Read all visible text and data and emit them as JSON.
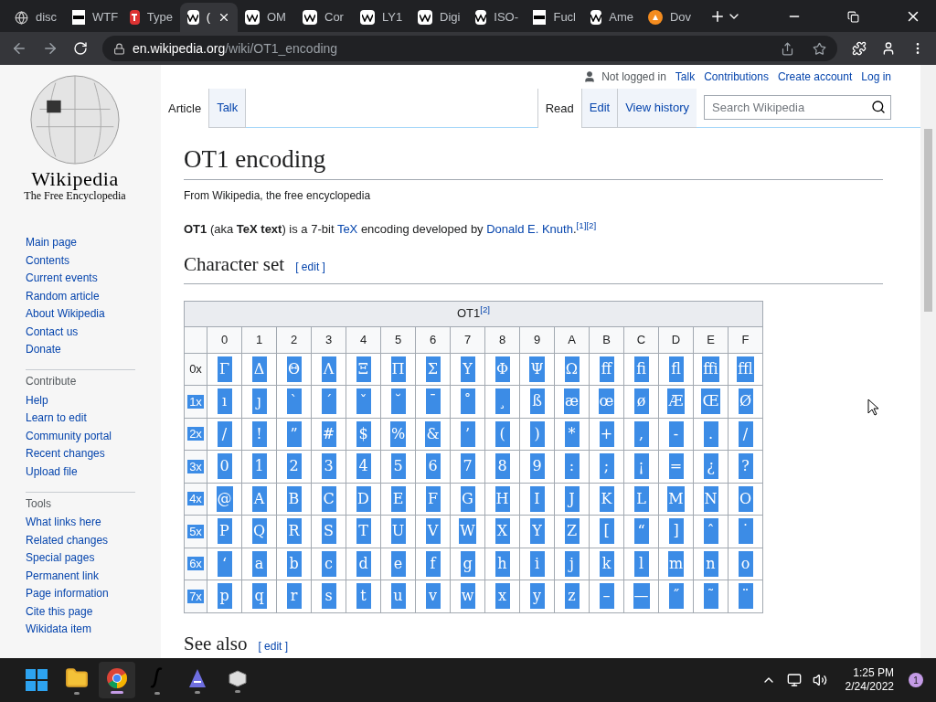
{
  "browser": {
    "tabs": [
      {
        "title": "disc",
        "kind": "globe",
        "selected": false
      },
      {
        "title": "WTF",
        "kind": "wtf",
        "selected": false
      },
      {
        "title": "Type",
        "kind": "t",
        "selected": false
      },
      {
        "title": "(",
        "kind": "w",
        "selected": true
      },
      {
        "title": "OM",
        "kind": "w",
        "selected": false
      },
      {
        "title": "Cor",
        "kind": "w",
        "selected": false
      },
      {
        "title": "LY1",
        "kind": "w",
        "selected": false
      },
      {
        "title": "Digi",
        "kind": "w",
        "selected": false
      },
      {
        "title": "ISO-",
        "kind": "w",
        "selected": false
      },
      {
        "title": "Fucl",
        "kind": "wtf",
        "selected": false
      },
      {
        "title": "Ame",
        "kind": "w",
        "selected": false
      },
      {
        "title": "Dov",
        "kind": "fire",
        "selected": false
      }
    ],
    "url_host": "en.wikipedia.org",
    "url_path": "/wiki/OT1_encoding"
  },
  "logo": {
    "wordmark": "Wikipedia",
    "tagline": "The Free Encyclopedia"
  },
  "sidebar": {
    "main": [
      "Main page",
      "Contents",
      "Current events",
      "Random article",
      "About Wikipedia",
      "Contact us",
      "Donate"
    ],
    "sections": [
      {
        "heading": "Contribute",
        "items": [
          "Help",
          "Learn to edit",
          "Community portal",
          "Recent changes",
          "Upload file"
        ]
      },
      {
        "heading": "Tools",
        "items": [
          "What links here",
          "Related changes",
          "Special pages",
          "Permanent link",
          "Page information",
          "Cite this page",
          "Wikidata item"
        ]
      }
    ]
  },
  "personal": {
    "status": "Not logged in",
    "links": [
      "Talk",
      "Contributions",
      "Create account",
      "Log in"
    ]
  },
  "page_tabs": [
    {
      "label": "Article",
      "selected": true
    },
    {
      "label": "Talk",
      "selected": false
    }
  ],
  "view_tabs": [
    {
      "label": "Read",
      "selected": true
    },
    {
      "label": "Edit",
      "selected": false
    },
    {
      "label": "View history",
      "selected": false
    }
  ],
  "search": {
    "placeholder": "Search Wikipedia"
  },
  "article": {
    "title": "OT1 encoding",
    "tagline": "From Wikipedia, the free encyclopedia",
    "intro_parts": [
      {
        "kind": "bold",
        "text": "OT1"
      },
      {
        "kind": "text",
        "text": " (aka "
      },
      {
        "kind": "bold",
        "text": "TeX text"
      },
      {
        "kind": "text",
        "text": ") is a 7-bit "
      },
      {
        "kind": "link",
        "text": "TeX"
      },
      {
        "kind": "text",
        "text": " encoding developed by "
      },
      {
        "kind": "link",
        "text": "Donald E. Knuth"
      },
      {
        "kind": "text",
        "text": "."
      },
      {
        "kind": "ref",
        "text": "[1]"
      },
      {
        "kind": "ref",
        "text": "[2]"
      }
    ],
    "section": {
      "heading": "Character set",
      "edit": "[ edit ]"
    },
    "next_section": {
      "heading": "See also",
      "edit": "[ edit ]"
    }
  },
  "table": {
    "caption": "OT1",
    "caption_ref": "[2]",
    "columns": [
      "0",
      "1",
      "2",
      "3",
      "4",
      "5",
      "6",
      "7",
      "8",
      "9",
      "A",
      "B",
      "C",
      "D",
      "E",
      "F"
    ],
    "rows": [
      {
        "label": "0x",
        "label_selected": false,
        "cells_selected": true,
        "cells": [
          "Γ",
          "Δ",
          "Θ",
          "Λ",
          "Ξ",
          "Π",
          "Σ",
          "Υ",
          "Φ",
          "Ψ",
          "Ω",
          "ff",
          "fi",
          "fl",
          "ffi",
          "ffl"
        ]
      },
      {
        "label": "1x",
        "label_selected": true,
        "cells_selected": true,
        "cells": [
          "ı",
          "ȷ",
          "`",
          "´",
          "ˇ",
          "˘",
          "¯",
          "˚",
          "¸",
          "ß",
          "æ",
          "œ",
          "ø",
          "Æ",
          "Œ",
          "Ø"
        ]
      },
      {
        "label": "2x",
        "label_selected": true,
        "cells_selected": true,
        "cells": [
          "/",
          "!",
          "”",
          "#",
          "$",
          "%",
          "&",
          "’",
          "(",
          ")",
          "*",
          "+",
          ",",
          "-",
          ".",
          "/"
        ]
      },
      {
        "label": "3x",
        "label_selected": true,
        "cells_selected": true,
        "cells": [
          "0",
          "1",
          "2",
          "3",
          "4",
          "5",
          "6",
          "7",
          "8",
          "9",
          ":",
          ";",
          "¡",
          "=",
          "¿",
          "?"
        ]
      },
      {
        "label": "4x",
        "label_selected": true,
        "cells_selected": true,
        "cells": [
          "@",
          "A",
          "B",
          "C",
          "D",
          "E",
          "F",
          "G",
          "H",
          "I",
          "J",
          "K",
          "L",
          "M",
          "N",
          "O"
        ]
      },
      {
        "label": "5x",
        "label_selected": true,
        "cells_selected": true,
        "cells": [
          "P",
          "Q",
          "R",
          "S",
          "T",
          "U",
          "V",
          "W",
          "X",
          "Y",
          "Z",
          "[",
          "“",
          "]",
          "ˆ",
          "˙"
        ]
      },
      {
        "label": "6x",
        "label_selected": true,
        "cells_selected": true,
        "cells": [
          "‘",
          "a",
          "b",
          "c",
          "d",
          "e",
          "f",
          "g",
          "h",
          "i",
          "j",
          "k",
          "l",
          "m",
          "n",
          "o"
        ]
      },
      {
        "label": "7x",
        "label_selected": true,
        "cells_selected": true,
        "cells": [
          "p",
          "q",
          "r",
          "s",
          "t",
          "u",
          "v",
          "w",
          "x",
          "y",
          "z",
          "–",
          "—",
          "˝",
          "˜",
          "¨"
        ]
      }
    ]
  },
  "taskbar": {
    "apps": [
      {
        "kind": "start",
        "selected": false
      },
      {
        "kind": "folder",
        "selected": false
      },
      {
        "kind": "chrome",
        "selected": true
      },
      {
        "kind": "script",
        "selected": false
      },
      {
        "kind": "editor",
        "selected": false
      },
      {
        "kind": "box",
        "selected": false
      }
    ],
    "time": "1:25 PM",
    "date": "2/24/2022",
    "notifications": "1"
  }
}
